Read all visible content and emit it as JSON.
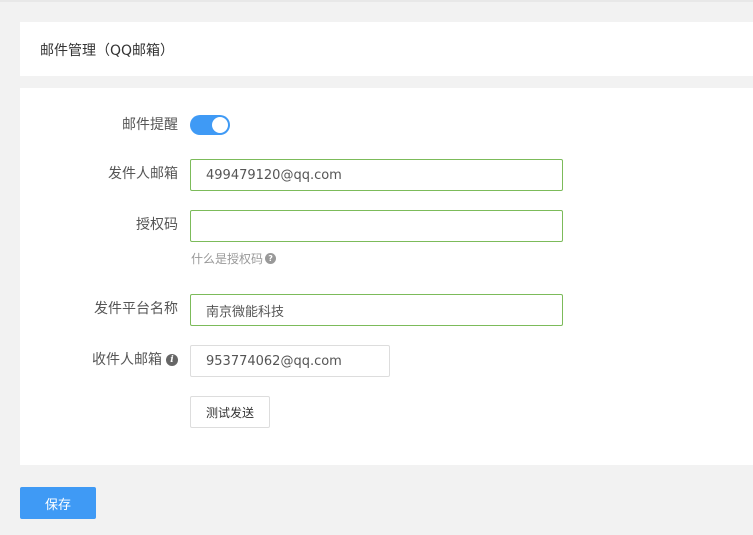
{
  "header": {
    "title": "邮件管理（QQ邮箱）"
  },
  "form": {
    "reminder": {
      "label": "邮件提醒",
      "enabled": true
    },
    "sender_email": {
      "label": "发件人邮箱",
      "value": "499479120@qq.com"
    },
    "auth_code": {
      "label": "授权码",
      "value": "",
      "help": "什么是授权码",
      "help_icon": "?"
    },
    "platform_name": {
      "label": "发件平台名称",
      "value": "南京微能科技"
    },
    "recipient_email": {
      "label": "收件人邮箱",
      "value": "953774062@qq.com",
      "info_icon": "i"
    },
    "test_send_label": "测试发送"
  },
  "footer": {
    "save_label": "保存"
  },
  "colors": {
    "accent": "#3f9af5",
    "valid_border": "#7cbb5a"
  }
}
